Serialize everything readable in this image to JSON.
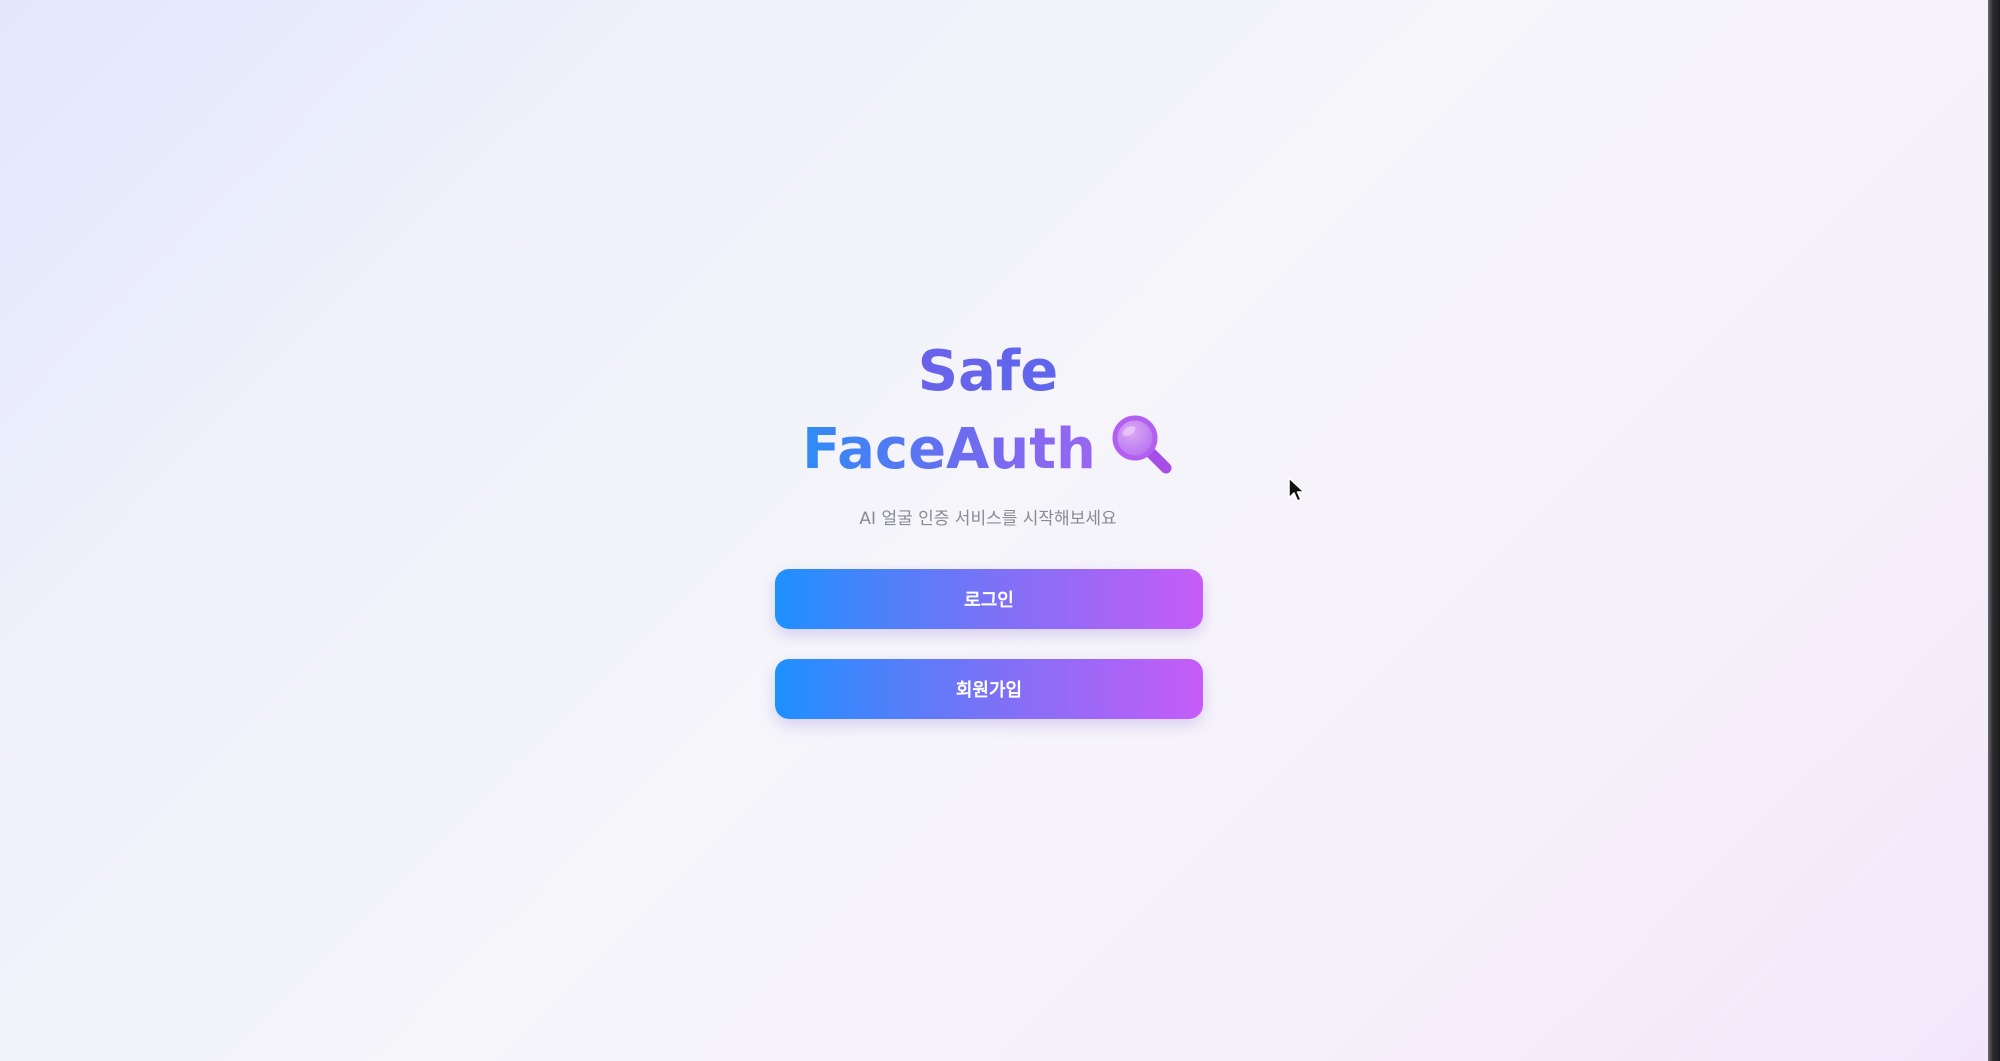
{
  "app": {
    "title_line1": "Safe",
    "title_line2": "FaceAuth",
    "title_icon": "magnifying-glass-icon",
    "subtitle": "AI 얼굴 인증 서비스를 시작해보세요"
  },
  "actions": {
    "login_label": "로그인",
    "signup_label": "회원가입"
  },
  "colors": {
    "gradient_start": "#1e90ff",
    "gradient_mid": "#7a72f6",
    "gradient_end": "#c65cf8",
    "subtitle_text": "#8a8a92"
  }
}
